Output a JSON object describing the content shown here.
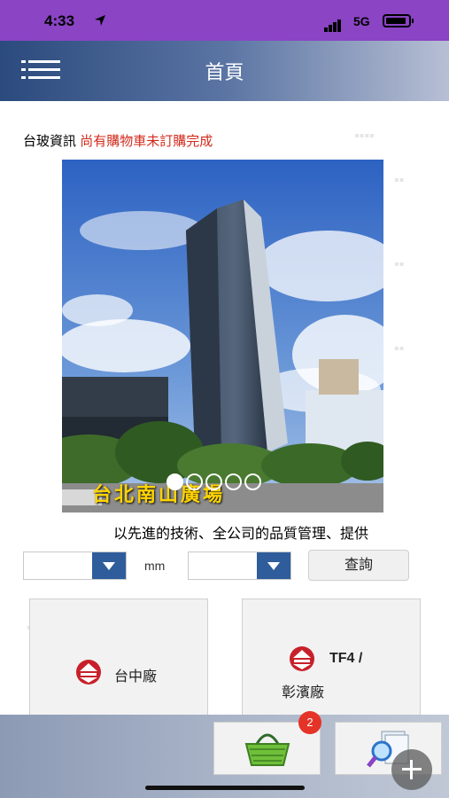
{
  "status_bar": {
    "time": "4:33",
    "network": "5G"
  },
  "header": {
    "title": "首頁"
  },
  "info": {
    "company": "台玻資訊",
    "alert": "尚有購物車未訂購完成"
  },
  "banner": {
    "caption": "台北南山廣場",
    "slide_count": 5,
    "active_slide": 1
  },
  "marquee_text": "以先進的技術、全公司的品質管理、提供",
  "search": {
    "unit": "mm",
    "query_label": "查詢"
  },
  "plants": [
    {
      "label": "台中廠"
    },
    {
      "label_line1": "TF4 /",
      "label_line2": "彰濱廠"
    }
  ],
  "cart": {
    "badge_count": "2"
  },
  "colors": {
    "status_bar": "#8a44c4",
    "accent_blue": "#2f5d9c",
    "alert_red": "#d22a1c",
    "logo_red": "#c8202a"
  },
  "icons": {
    "menu": "menu-icon",
    "cart": "basket-icon",
    "search": "magnifier-icon",
    "fab": "plus-icon"
  }
}
